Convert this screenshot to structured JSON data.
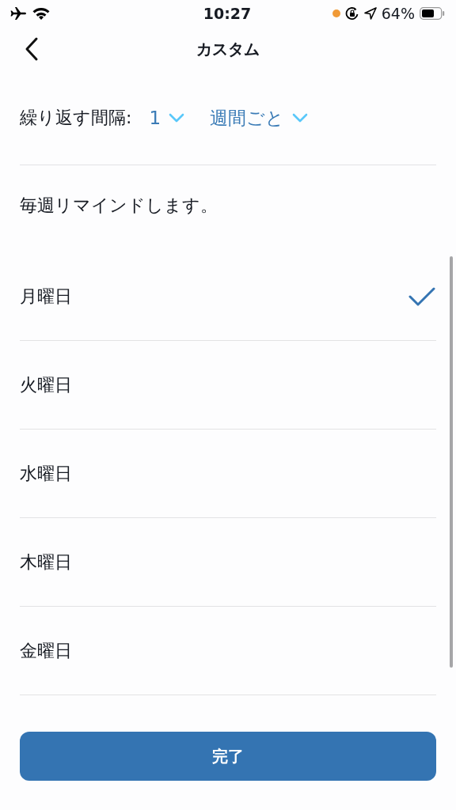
{
  "status_bar": {
    "time": "10:27",
    "battery": "64%"
  },
  "nav": {
    "title": "カスタム"
  },
  "repeat": {
    "label": "繰り返す間隔:",
    "interval": "1",
    "unit": "週間ごと"
  },
  "description": "毎週リマインドします。",
  "days": [
    {
      "label": "月曜日",
      "selected": true
    },
    {
      "label": "火曜日",
      "selected": false
    },
    {
      "label": "水曜日",
      "selected": false
    },
    {
      "label": "木曜日",
      "selected": false
    },
    {
      "label": "金曜日",
      "selected": false
    }
  ],
  "done_button": "完了"
}
